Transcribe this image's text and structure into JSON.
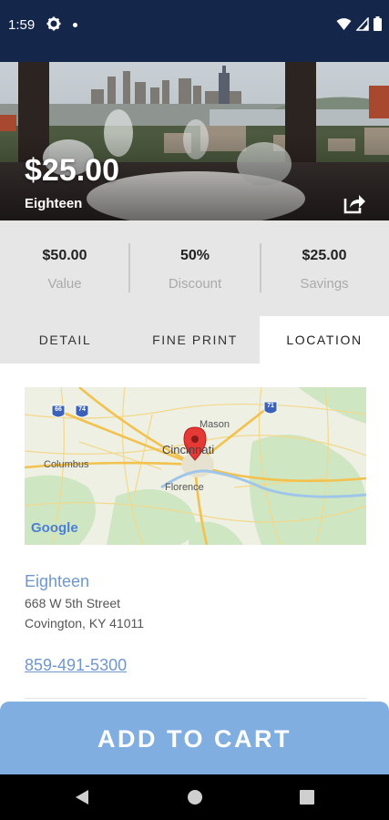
{
  "status_bar": {
    "time": "1:59",
    "icons": [
      "gear-icon",
      "notification-dot-icon",
      "wifi-icon",
      "signal-icon",
      "battery-icon"
    ]
  },
  "deal": {
    "price": "$25.00",
    "merchant": "Eighteen",
    "share_icon": "share-icon"
  },
  "stats": [
    {
      "value": "$50.00",
      "label": "Value"
    },
    {
      "value": "50%",
      "label": "Discount"
    },
    {
      "value": "$25.00",
      "label": "Savings"
    }
  ],
  "tabs": [
    {
      "label": "DETAIL",
      "active": false
    },
    {
      "label": "FINE PRINT",
      "active": false
    },
    {
      "label": "LOCATION",
      "active": true
    }
  ],
  "map": {
    "labels": [
      "Columbus",
      "Cincinnati",
      "Mason",
      "Florence"
    ],
    "highway_shields": [
      "66",
      "74",
      "71"
    ],
    "google_logo": "Google",
    "pin_icon": "map-pin-icon"
  },
  "location": {
    "name": "Eighteen",
    "address_line1": "668 W 5th Street",
    "address_line2": "Covington, KY 41011",
    "phone": "859-491-5300"
  },
  "cart_button": {
    "label": "ADD TO CART"
  },
  "nav_bar": {
    "icons": [
      "back-icon",
      "home-icon",
      "recents-icon"
    ]
  },
  "colors": {
    "header": "#14274b",
    "accent": "#80aee0",
    "link": "#6f97cf",
    "stats_bg": "#e6e6e6"
  }
}
